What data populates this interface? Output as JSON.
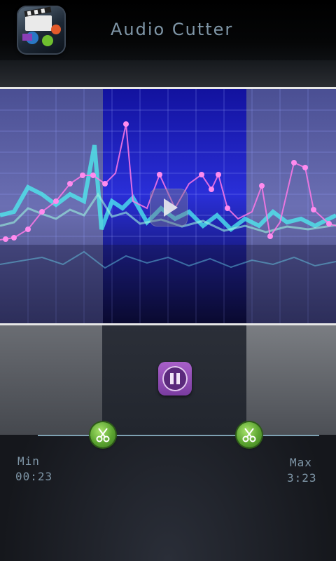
{
  "header": {
    "title": "Audio Cutter"
  },
  "range": {
    "min_label": "Min",
    "min_time": "00:23",
    "max_label": "Max",
    "max_time": "3:23"
  }
}
